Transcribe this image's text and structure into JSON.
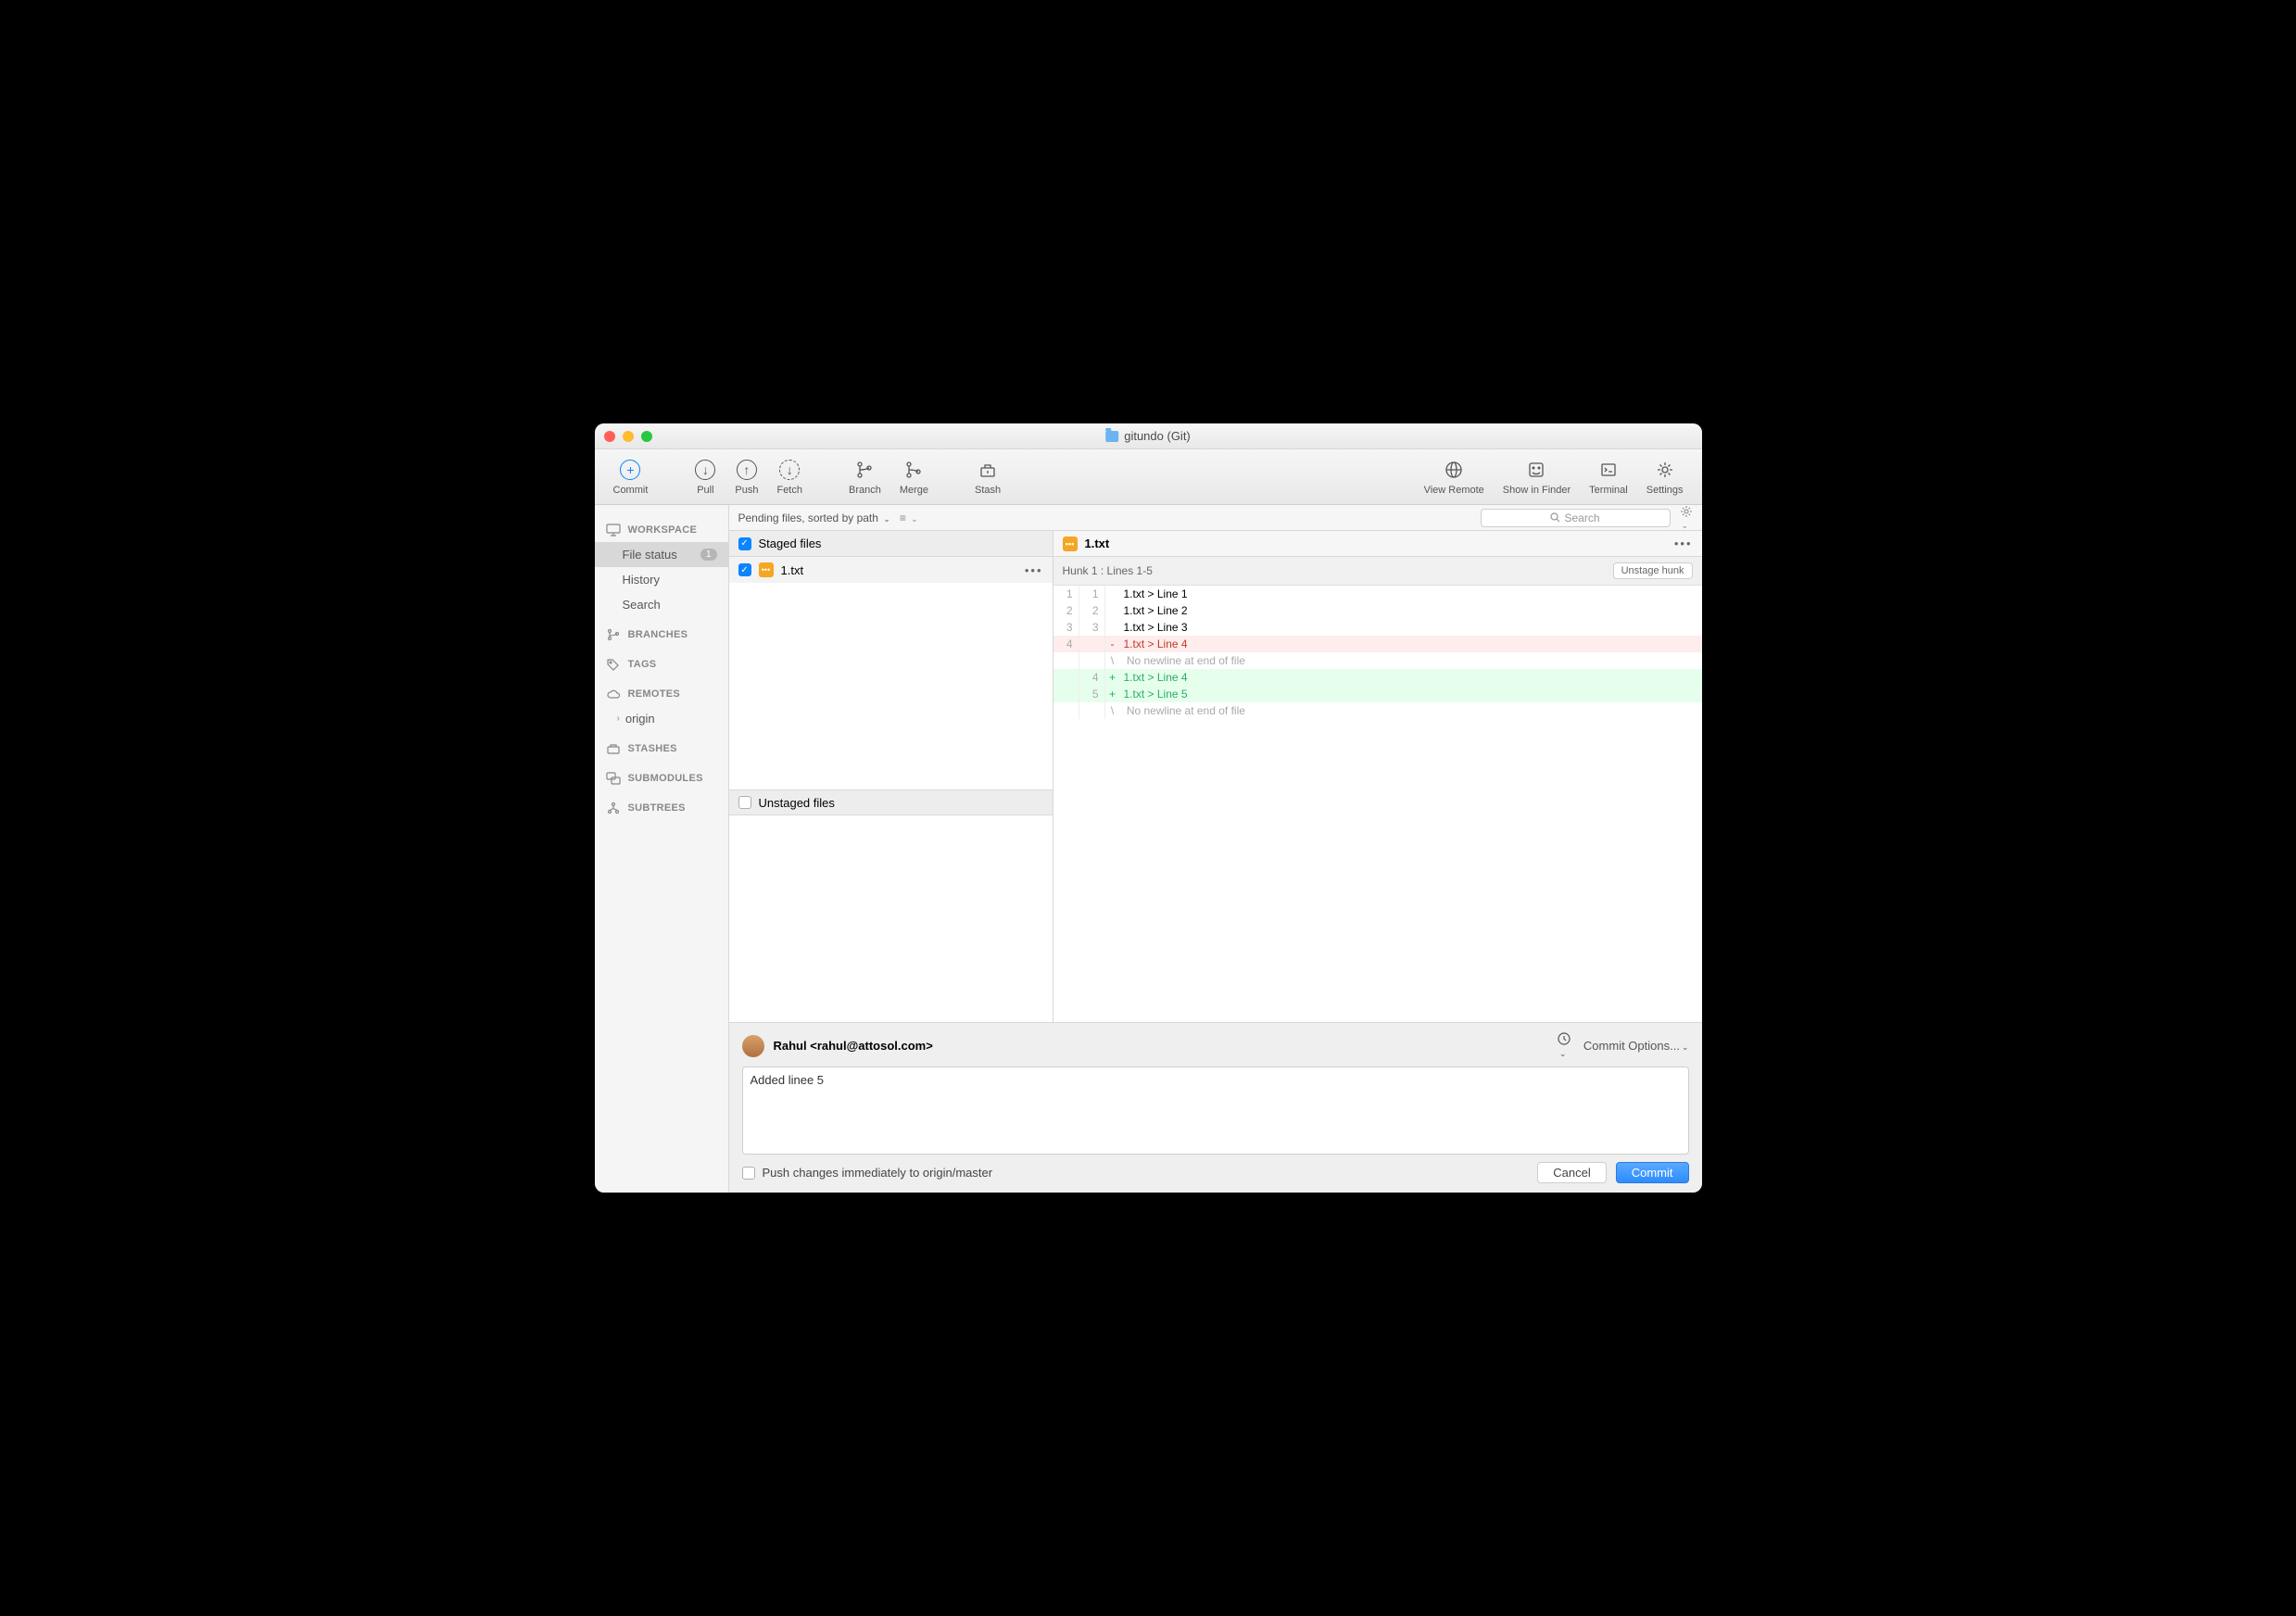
{
  "window": {
    "title": "gitundo (Git)"
  },
  "toolbar": {
    "commit": "Commit",
    "pull": "Pull",
    "push": "Push",
    "fetch": "Fetch",
    "branch": "Branch",
    "merge": "Merge",
    "stash": "Stash",
    "view_remote": "View Remote",
    "show_in_finder": "Show in Finder",
    "terminal": "Terminal",
    "settings": "Settings"
  },
  "sidebar": {
    "workspace": "WORKSPACE",
    "file_status": "File status",
    "file_status_badge": "1",
    "history": "History",
    "search": "Search",
    "branches": "BRANCHES",
    "tags": "TAGS",
    "remotes": "REMOTES",
    "origin": "origin",
    "stashes": "STASHES",
    "submodules": "SUBMODULES",
    "subtrees": "SUBTREES"
  },
  "filterbar": {
    "label": "Pending files, sorted by path",
    "search_placeholder": "Search"
  },
  "filelist": {
    "staged_header": "Staged files",
    "unstaged_header": "Unstaged files",
    "file1": "1.txt"
  },
  "diff": {
    "filename": "1.txt",
    "hunk_header": "Hunk 1 : Lines 1-5",
    "unstage_label": "Unstage hunk",
    "lines": [
      {
        "old": "1",
        "new": "1",
        "sign": " ",
        "text": "1.txt > Line 1",
        "cls": ""
      },
      {
        "old": "2",
        "new": "2",
        "sign": " ",
        "text": "1.txt > Line 2",
        "cls": ""
      },
      {
        "old": "3",
        "new": "3",
        "sign": " ",
        "text": "1.txt > Line 3",
        "cls": ""
      },
      {
        "old": "4",
        "new": "",
        "sign": "-",
        "text": "1.txt > Line 4",
        "cls": "del"
      },
      {
        "old": "",
        "new": "",
        "sign": "\\",
        "text": " No newline at end of file",
        "cls": "meta"
      },
      {
        "old": "",
        "new": "4",
        "sign": "+",
        "text": "1.txt > Line 4",
        "cls": "add"
      },
      {
        "old": "",
        "new": "5",
        "sign": "+",
        "text": "1.txt > Line 5",
        "cls": "add"
      },
      {
        "old": "",
        "new": "",
        "sign": "\\",
        "text": " No newline at end of file",
        "cls": "meta"
      }
    ]
  },
  "commit": {
    "author": "Rahul <rahul@attosol.com>",
    "options": "Commit Options...",
    "message": "Added linee 5",
    "push_label": "Push changes immediately to origin/master",
    "cancel": "Cancel",
    "commit": "Commit"
  }
}
